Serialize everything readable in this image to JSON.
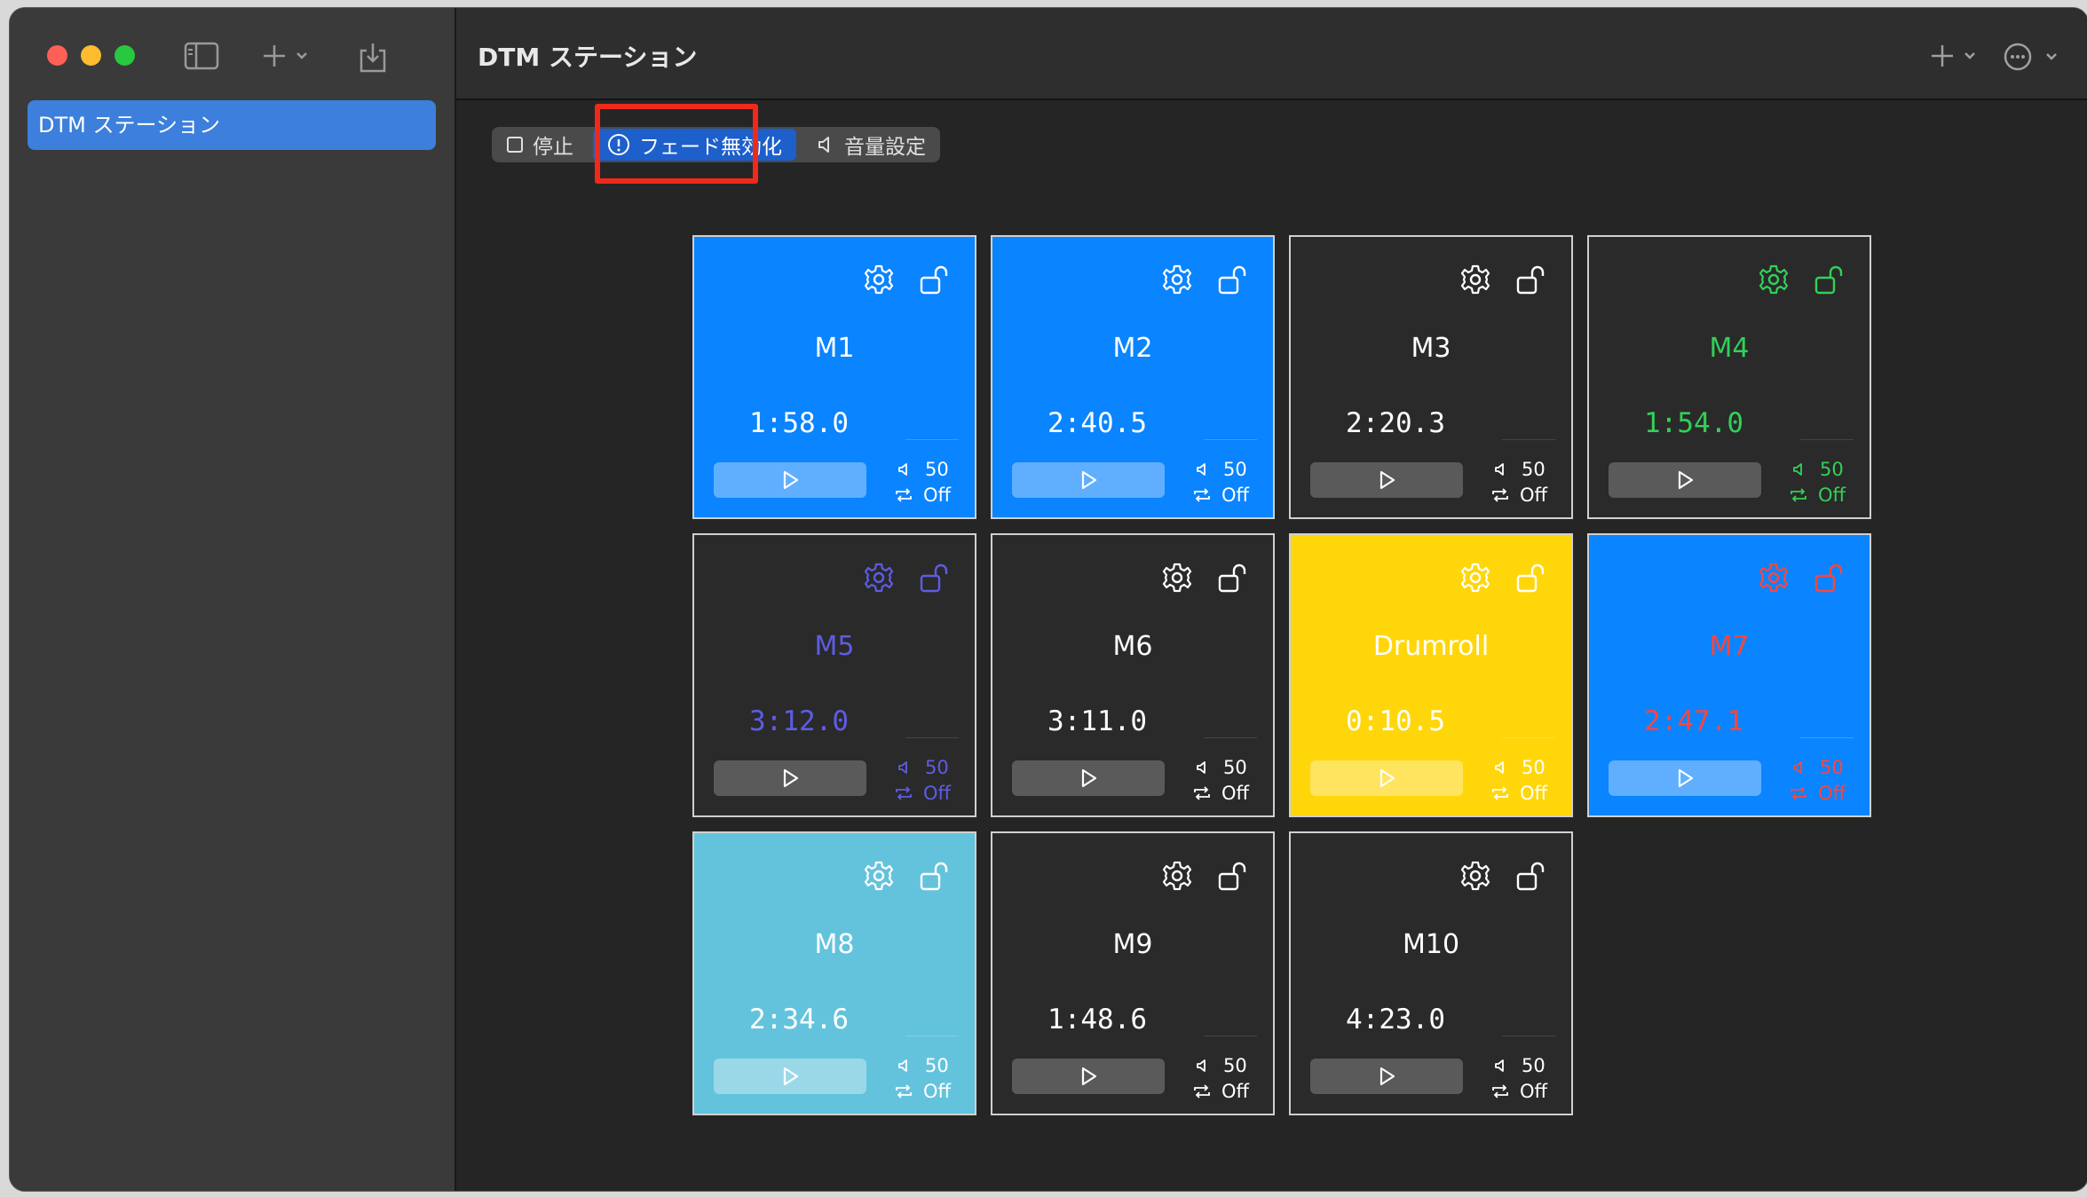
{
  "window": {
    "title": "DTM ステーション"
  },
  "sidebar": {
    "items": [
      {
        "label": "DTM ステーション"
      }
    ]
  },
  "toolbar": {
    "stop_label": "停止",
    "fade_label": "フェード無効化",
    "volume_label": "音量設定"
  },
  "tiles": [
    {
      "name": "M1",
      "time": "1:58.0",
      "volume": "50",
      "repeat": "Off",
      "bg": "#0a84ff",
      "fg": "#ffffff"
    },
    {
      "name": "M2",
      "time": "2:40.5",
      "volume": "50",
      "repeat": "Off",
      "bg": "#0a84ff",
      "fg": "#ffffff"
    },
    {
      "name": "M3",
      "time": "2:20.3",
      "volume": "50",
      "repeat": "Off",
      "bg": "#2a2a2a",
      "fg": "#ffffff"
    },
    {
      "name": "M4",
      "time": "1:54.0",
      "volume": "50",
      "repeat": "Off",
      "bg": "#2a2a2a",
      "fg": "#30d158"
    },
    {
      "name": "M5",
      "time": "3:12.0",
      "volume": "50",
      "repeat": "Off",
      "bg": "#2a2a2a",
      "fg": "#5e5ce6"
    },
    {
      "name": "M6",
      "time": "3:11.0",
      "volume": "50",
      "repeat": "Off",
      "bg": "#2a2a2a",
      "fg": "#ffffff"
    },
    {
      "name": "Drumroll",
      "time": "0:10.5",
      "volume": "50",
      "repeat": "Off",
      "bg": "#ffd60a",
      "fg": "#ffffff"
    },
    {
      "name": "M7",
      "time": "2:47.1",
      "volume": "50",
      "repeat": "Off",
      "bg": "#0a84ff",
      "fg": "#ff453a"
    },
    {
      "name": "M8",
      "time": "2:34.6",
      "volume": "50",
      "repeat": "Off",
      "bg": "#64c3dc",
      "fg": "#ffffff"
    },
    {
      "name": "M9",
      "time": "1:48.6",
      "volume": "50",
      "repeat": "Off",
      "bg": "#2a2a2a",
      "fg": "#ffffff"
    },
    {
      "name": "M10",
      "time": "4:23.0",
      "volume": "50",
      "repeat": "Off",
      "bg": "#2a2a2a",
      "fg": "#ffffff"
    }
  ]
}
